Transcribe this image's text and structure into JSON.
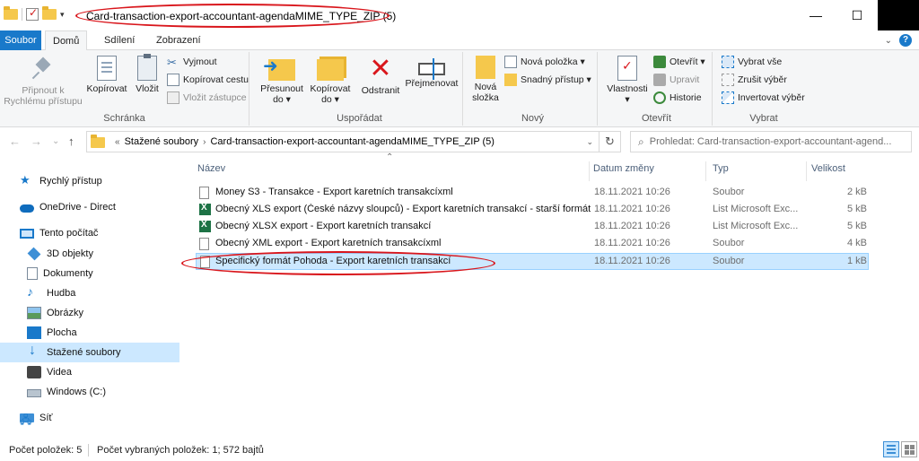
{
  "window": {
    "title": "Card-transaction-export-accountant-agendaMIME_TYPE_ZIP (5)",
    "controls": {
      "minimize": "—",
      "maximize": "☐",
      "close": "✕"
    }
  },
  "ribbon_tabs": {
    "file": "Soubor",
    "home": "Domů",
    "share": "Sdílení",
    "view": "Zobrazení",
    "collapse": "⌄",
    "help": "?"
  },
  "ribbon": {
    "clipboard": {
      "label": "Schránka",
      "pin": "Připnout k Rychlému přístupu",
      "copy": "Kopírovat",
      "paste": "Vložit",
      "cut": "Vyjmout",
      "copy_path": "Kopírovat cestu",
      "paste_shortcut": "Vložit zástupce"
    },
    "organize": {
      "label": "Uspořádat",
      "move_to": "Přesunout do ▾",
      "copy_to": "Kopírovat do ▾",
      "delete": "Odstranit",
      "rename": "Přejmenovat"
    },
    "new": {
      "label": "Nový",
      "new_folder": "Nová složka",
      "new_item": "Nová položka ▾",
      "easy_access": "Snadný přístup ▾"
    },
    "open": {
      "label": "Otevřít",
      "properties": "Vlastnosti",
      "properties_dd": "▾",
      "open": "Otevřít ▾",
      "edit": "Upravit",
      "history": "Historie"
    },
    "select": {
      "label": "Vybrat",
      "select_all": "Vybrat vše",
      "select_none": "Zrušit výběr",
      "invert": "Invertovat výběr"
    }
  },
  "nav": {
    "back": "←",
    "forward": "→",
    "recent": "⌄",
    "up": "↑",
    "breadcrumb_root": "«",
    "breadcrumb": [
      "Stažené soubory",
      "Card-transaction-export-accountant-agendaMIME_TYPE_ZIP (5)"
    ],
    "breadcrumb_sep": "›",
    "dropdown": "⌄",
    "refresh": "↻",
    "search_placeholder": "Prohledat: Card-transaction-export-accountant-agend..."
  },
  "sidebar": {
    "items": [
      {
        "label": "Rychlý přístup",
        "icon": "star-icon"
      },
      {
        "label": "OneDrive - Direct",
        "icon": "cloud-icon"
      },
      {
        "label": "Tento počítač",
        "icon": "computer-icon"
      },
      {
        "label": "3D objekty",
        "icon": "cube-icon"
      },
      {
        "label": "Dokumenty",
        "icon": "document-icon"
      },
      {
        "label": "Hudba",
        "icon": "music-icon"
      },
      {
        "label": "Obrázky",
        "icon": "pictures-icon"
      },
      {
        "label": "Plocha",
        "icon": "desktop-icon"
      },
      {
        "label": "Stažené soubory",
        "icon": "download-icon"
      },
      {
        "label": "Videa",
        "icon": "video-icon"
      },
      {
        "label": "Windows (C:)",
        "icon": "drive-icon"
      },
      {
        "label": "Síť",
        "icon": "network-icon"
      }
    ]
  },
  "filelist": {
    "columns": {
      "name": "Název",
      "date": "Datum změny",
      "type": "Typ",
      "size": "Velikost"
    },
    "rows": [
      {
        "name": "Money S3 - Transakce - Export karetních transakcíxml",
        "date": "18.11.2021 10:26",
        "type": "Soubor",
        "size": "2 kB",
        "icon": "file-icon"
      },
      {
        "name": "Obecný XLS export (České názvy sloupců) - Export karetních transakcí - starší formát",
        "date": "18.11.2021 10:26",
        "type": "List Microsoft Exc...",
        "size": "5 kB",
        "icon": "excel-icon"
      },
      {
        "name": "Obecný XLSX export - Export karetních transakcí",
        "date": "18.11.2021 10:26",
        "type": "List Microsoft Exc...",
        "size": "5 kB",
        "icon": "excel-icon"
      },
      {
        "name": "Obecný XML export - Export karetních transakcíxml",
        "date": "18.11.2021 10:26",
        "type": "Soubor",
        "size": "4 kB",
        "icon": "file-icon"
      },
      {
        "name": "Specifický formát Pohoda - Export karetních transakcí",
        "date": "18.11.2021 10:26",
        "type": "Soubor",
        "size": "1 kB",
        "icon": "file-icon"
      }
    ]
  },
  "status": {
    "count": "Počet položek: 5",
    "selected": "Počet vybraných položek: 1; 572 bajtů"
  },
  "colors": {
    "accent": "#1979ca",
    "highlight_oval": "#d9161c",
    "selection": "#cce8ff"
  }
}
